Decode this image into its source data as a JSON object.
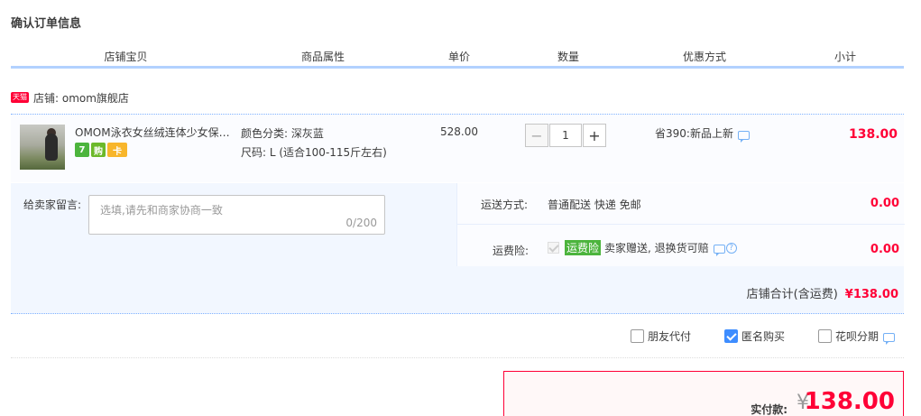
{
  "page_title": "确认订单信息",
  "columns": [
    "店铺宝贝",
    "商品属性",
    "单价",
    "数量",
    "优惠方式",
    "小计"
  ],
  "shop": {
    "badge": "天猫",
    "label": "店铺: omom旗舰店"
  },
  "item": {
    "name": "OMOM泳衣女丝绒连体少女保守遮肚显瘦",
    "badges": [
      "7",
      "购",
      "卡"
    ],
    "color_attr": "颜色分类: 深灰蓝",
    "size_attr": "尺码: L (适合100-115斤左右)",
    "unit_price": "528.00",
    "quantity": "1",
    "minus": "−",
    "plus": "+",
    "discount": "省390:新品上新",
    "subtotal": "138.00"
  },
  "memo": {
    "label": "给卖家留言:",
    "placeholder": "选填,请先和商家协商一致",
    "counter": "0/200"
  },
  "shipping": {
    "label": "运送方式:",
    "value": "普通配送 快递 免邮",
    "amount": "0.00"
  },
  "insurance": {
    "label": "运费险:",
    "tag": "运费险",
    "text": "卖家赠送, 退换货可赔",
    "help": "?",
    "amount": "0.00"
  },
  "shop_total": {
    "label": "店铺合计(含运费)",
    "amount": "¥138.00"
  },
  "options": [
    {
      "label": "朋友代付",
      "checked": false
    },
    {
      "label": "匿名购买",
      "checked": true
    },
    {
      "label": "花呗分期",
      "checked": false
    }
  ],
  "payment": {
    "label": "实付款:",
    "currency": "¥",
    "amount": "138.00"
  },
  "colors": {
    "accent_red": "#ff0036",
    "header_line": "#b2d1ff",
    "check_blue": "#3e8dff",
    "tag_green": "#4cb43d"
  }
}
